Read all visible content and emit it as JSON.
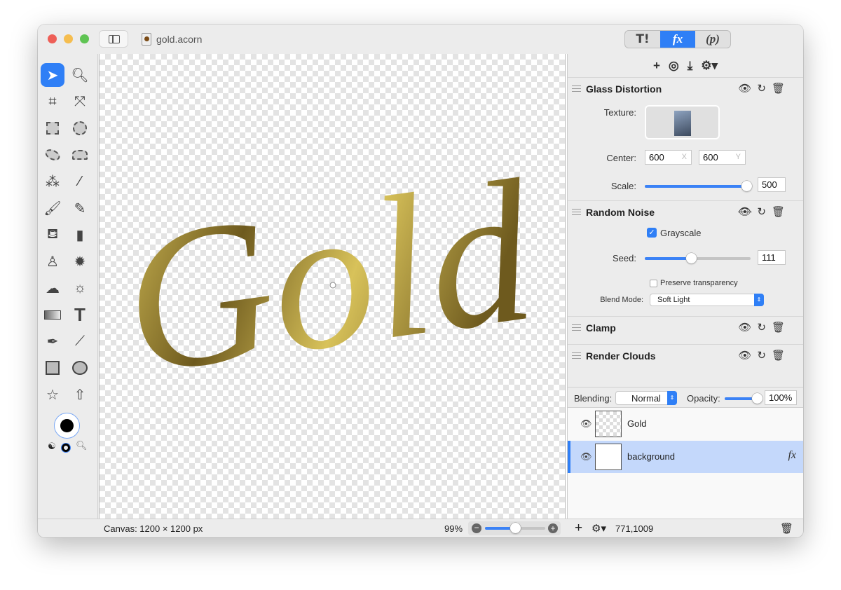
{
  "window": {
    "title": "gold.acorn",
    "traffic": {
      "close": "#ee5f57",
      "minimize": "#f5bd4f",
      "zoom": "#5fc453"
    }
  },
  "mode_segments": [
    {
      "icon": "hammer-brush-icon",
      "label": "T!"
    },
    {
      "icon": "fx-icon",
      "label": "fx"
    },
    {
      "icon": "p-icon",
      "label": "(p)"
    }
  ],
  "fx_toolbar": {
    "add": "+",
    "icons": [
      "plus-icon",
      "filter-presets-icon",
      "download-icon",
      "gear-icon"
    ]
  },
  "filters": [
    {
      "name": "Glass Distortion",
      "visible": true,
      "texture_label": "Texture:",
      "center_label": "Center:",
      "center_x": "600",
      "center_y": "600",
      "x_ph": "X",
      "y_ph": "Y",
      "scale_label": "Scale:",
      "scale_value": "500",
      "scale_fraction": 1.0
    },
    {
      "name": "Random Noise",
      "visible": false,
      "grayscale_label": "Grayscale",
      "grayscale": true,
      "seed_label": "Seed:",
      "seed_value": "111",
      "seed_fraction": 0.44,
      "preserve_label": "Preserve transparency",
      "preserve": false,
      "blend_label": "Blend Mode:",
      "blend_value": "Soft Light"
    },
    {
      "name": "Clamp",
      "visible": true
    },
    {
      "name": "Render Clouds",
      "visible": true
    }
  ],
  "layer_options": {
    "blending_label": "Blending:",
    "blending_value": "Normal",
    "opacity_label": "Opacity:",
    "opacity_value": "100%",
    "opacity_fraction": 1.0
  },
  "layers": [
    {
      "name": "Gold",
      "visible": true,
      "selected": false
    },
    {
      "name": "background",
      "visible": true,
      "selected": true,
      "fx": "fx"
    }
  ],
  "canvas": {
    "artwork_text": "Gold"
  },
  "status": {
    "canvas_size": "Canvas: 1200 × 1200 px",
    "zoom": "99%",
    "zoom_fraction": 0.5,
    "coords": "771,1009"
  },
  "colors": {
    "accent": "#2f7ff6",
    "selection": "#c4d8fb",
    "gold_light": "#d8c25a",
    "gold_dark": "#6e5a1e"
  }
}
